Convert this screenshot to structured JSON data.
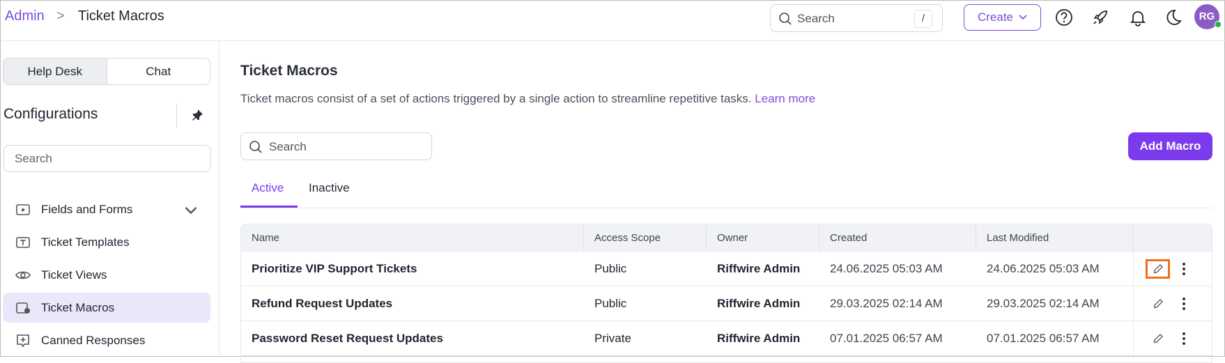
{
  "header": {
    "breadcrumb_root": "Admin",
    "breadcrumb_sep": ">",
    "breadcrumb_current": "Ticket Macros",
    "search_placeholder": "Search",
    "search_shortcut": "/",
    "create_label": "Create",
    "avatar_initials": "RG"
  },
  "sidebar": {
    "toggle": [
      "Help Desk",
      "Chat"
    ],
    "title": "Configurations",
    "search_placeholder": "Search",
    "items": [
      {
        "label": "Fields and Forms"
      },
      {
        "label": "Ticket Templates"
      },
      {
        "label": "Ticket Views"
      },
      {
        "label": "Ticket Macros"
      },
      {
        "label": "Canned Responses"
      }
    ]
  },
  "main": {
    "title": "Ticket Macros",
    "description": "Ticket macros consist of a set of actions triggered by a single action to streamline repetitive tasks.",
    "learn_more": "Learn more",
    "search_placeholder": "Search",
    "add_button": "Add Macro",
    "tabs": [
      "Active",
      "Inactive"
    ],
    "columns": [
      "Name",
      "Access Scope",
      "Owner",
      "Created",
      "Last Modified"
    ],
    "rows": [
      [
        "Prioritize VIP Support Tickets",
        "Public",
        "Riffwire Admin",
        "24.06.2025 05:03 AM",
        "24.06.2025 05:03 AM"
      ],
      [
        "Refund Request Updates",
        "Public",
        "Riffwire Admin",
        "29.03.2025 02:14 AM",
        "29.03.2025 02:14 AM"
      ],
      [
        "Password Reset Request Updates",
        "Private",
        "Riffwire Admin",
        "07.01.2025 06:57 AM",
        "07.01.2025 06:57 AM"
      ]
    ]
  },
  "colors": {
    "accent": "#7c3aed",
    "highlight": "#f07014"
  }
}
